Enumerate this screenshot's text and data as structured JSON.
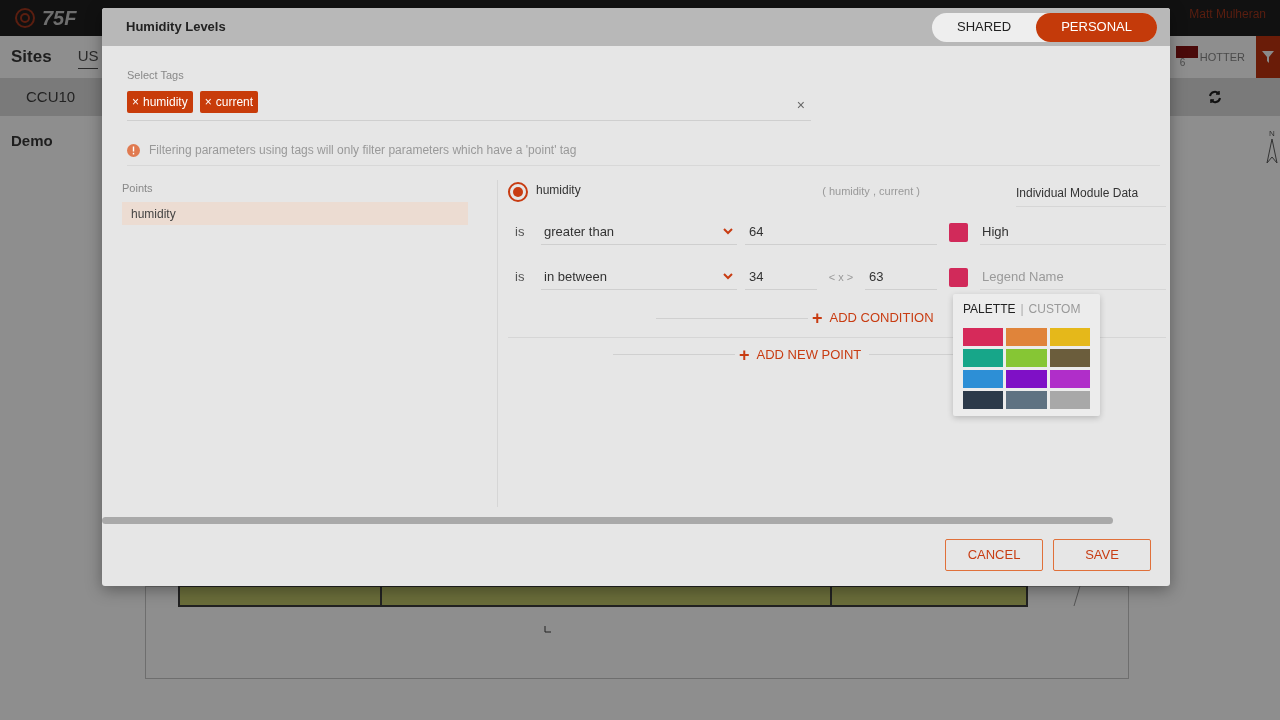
{
  "background": {
    "logo": "75F",
    "user": "Matt Mulheran",
    "title": "Sites",
    "tab": "US",
    "site": "CCU10",
    "building": "Demo",
    "legend_label": "HOTTER",
    "legend_value": "6",
    "compass": "N"
  },
  "dialog": {
    "title": "Humidity Levels",
    "scope": [
      {
        "label": "SHARED",
        "selected": false
      },
      {
        "label": "PERSONAL",
        "selected": true
      }
    ],
    "tags_label": "Select Tags",
    "tags": [
      {
        "remove": "×",
        "label": "humidity"
      },
      {
        "remove": "×",
        "label": "current"
      }
    ],
    "clear": "×",
    "info": "Filtering parameters using tags will only filter parameters which have a 'point' tag",
    "points_label": "Points",
    "points": [
      {
        "label": "humidity",
        "selected": true
      }
    ],
    "point": {
      "name": "humidity",
      "selected": true,
      "tags": "( humidity , current )",
      "source": "Individual Module Data",
      "conditions": [
        {
          "kind": "single",
          "is": "is",
          "operator": "greater than",
          "value": "64",
          "color": "#d12a5a",
          "legend": "High"
        },
        {
          "kind": "range",
          "is": "is",
          "operator": "in between",
          "min": "34",
          "between": "< x >",
          "max": "63",
          "color": "#d12a5a",
          "legend_placeholder": "Legend Name"
        }
      ]
    },
    "add_condition": {
      "icon": "+",
      "label": "ADD CONDITION"
    },
    "add_point": {
      "icon": "+",
      "label": "ADD NEW POINT"
    },
    "picker": {
      "tabs": [
        {
          "label": "PALETTE",
          "selected": true
        },
        {
          "label": "CUSTOM",
          "selected": false
        }
      ],
      "separator": "|",
      "swatches": [
        {
          "color": "#d62a5a"
        },
        {
          "color": "#e0843a"
        },
        {
          "color": "#e5b81a"
        },
        {
          "color": "#17a689"
        },
        {
          "color": "#86c634"
        },
        {
          "color": "#6b5d3c"
        },
        {
          "color": "#2d8fd6"
        },
        {
          "color": "#7f10c6"
        },
        {
          "color": "#b02ec9"
        },
        {
          "color": "#2c3a4a"
        },
        {
          "color": "#5f7282"
        },
        {
          "color": "#a8a8a8"
        }
      ]
    },
    "buttons": [
      {
        "label": "CANCEL"
      },
      {
        "label": "SAVE"
      }
    ]
  }
}
